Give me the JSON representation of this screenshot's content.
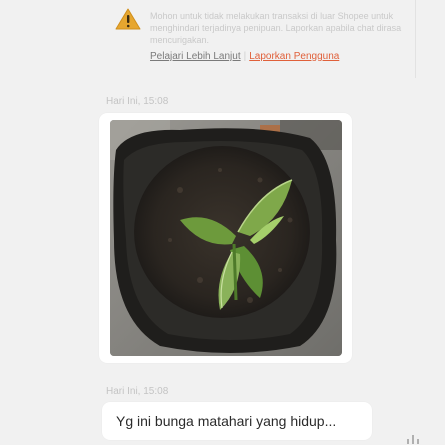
{
  "notice": {
    "text": "Mohon untuk tidak melakukan transaksi di luar Shopee untuk menghindari terjadinya penipuan. Laporkan apabila chat dirasa mencurigakan.",
    "learn_more": "Pelajari Lebih Lanjut",
    "separator": "|",
    "report": "Laporkan Pengguna",
    "icon": "warning-icon",
    "icon_color": "#e6a62f"
  },
  "messages": [
    {
      "time": "Hari Ini, 15:08",
      "type": "image",
      "image_alt": "Tanaman bunga matahari kecil di dalam polybag"
    },
    {
      "time": "Hari Ini, 15:08",
      "type": "text",
      "text": "Yg ini bunga matahari yang hidup..."
    }
  ],
  "colors": {
    "background": "#f1f1f1",
    "bubble": "#ffffff",
    "report_link": "#e0603a",
    "timestamp": "#c4c4c4"
  }
}
